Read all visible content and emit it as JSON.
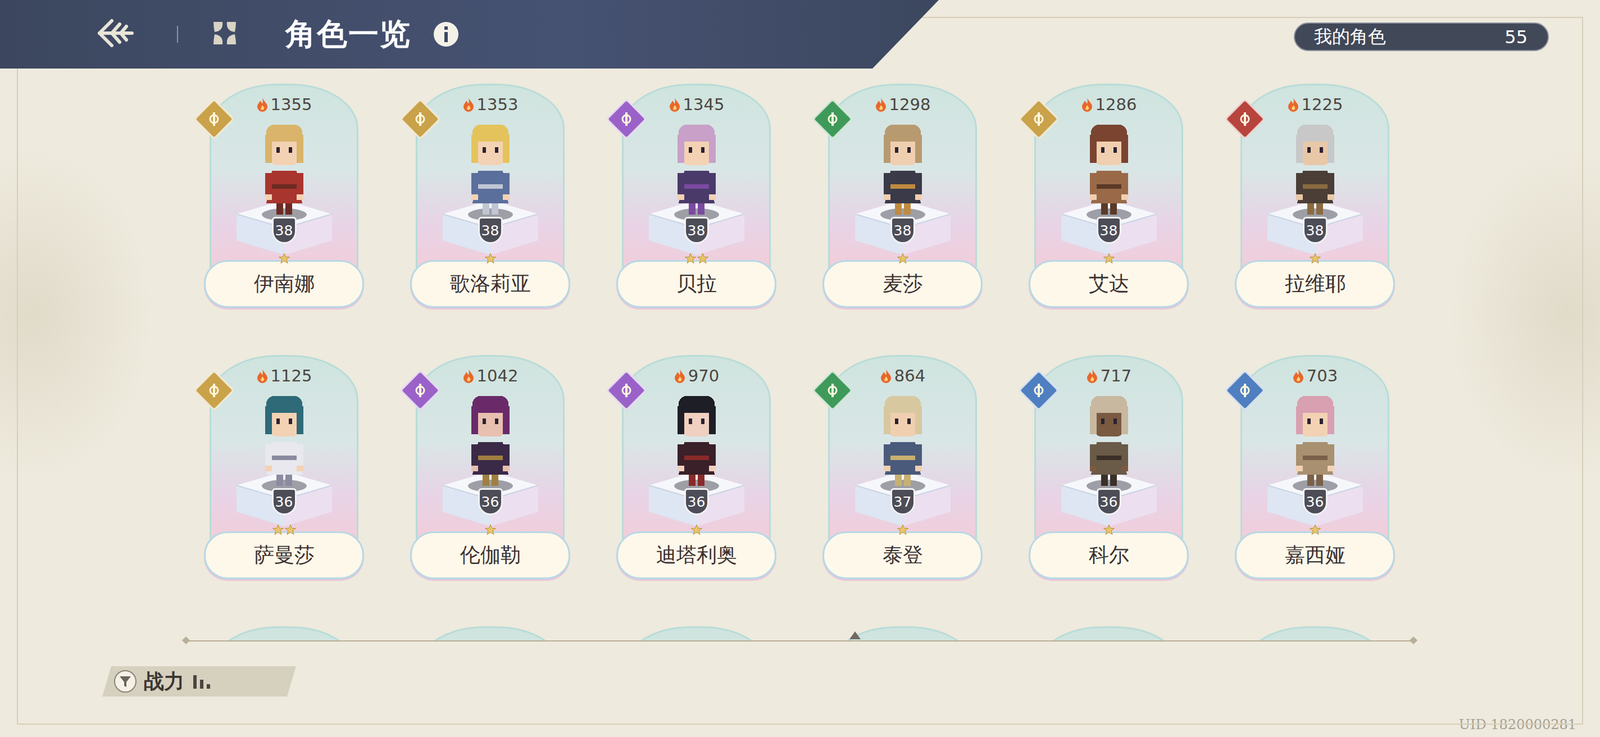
{
  "header": {
    "title": "角色一览"
  },
  "my_characters": {
    "label": "我的角色",
    "count": "55"
  },
  "characters": [
    {
      "name": "伊南娜",
      "power": "1355",
      "level": "38",
      "stars": 1,
      "color": "#c9a24a"
    },
    {
      "name": "歌洛莉亚",
      "power": "1353",
      "level": "38",
      "stars": 1,
      "color": "#c9a24a"
    },
    {
      "name": "贝拉",
      "power": "1345",
      "level": "38",
      "stars": 2,
      "color": "#9a62c8"
    },
    {
      "name": "麦莎",
      "power": "1298",
      "level": "38",
      "stars": 1,
      "color": "#3f9a5a"
    },
    {
      "name": "艾达",
      "power": "1286",
      "level": "38",
      "stars": 1,
      "color": "#c9a24a"
    },
    {
      "name": "拉维耶",
      "power": "1225",
      "level": "38",
      "stars": 1,
      "color": "#b8443e"
    },
    {
      "name": "萨曼莎",
      "power": "1125",
      "level": "36",
      "stars": 2,
      "color": "#c9a24a"
    },
    {
      "name": "伦伽勒",
      "power": "1042",
      "level": "36",
      "stars": 1,
      "color": "#9a62c8"
    },
    {
      "name": "迪塔利奥",
      "power": "970",
      "level": "36",
      "stars": 1,
      "color": "#9a62c8"
    },
    {
      "name": "泰登",
      "power": "864",
      "level": "37",
      "stars": 1,
      "color": "#3f9a5a"
    },
    {
      "name": "科尔",
      "power": "717",
      "level": "36",
      "stars": 1,
      "color": "#4f7fc0"
    },
    {
      "name": "嘉西娅",
      "power": "703",
      "level": "36",
      "stars": 1,
      "color": "#4f7fc0"
    }
  ],
  "sort_button": {
    "label": "战力"
  },
  "uid": "UID 1820000281"
}
